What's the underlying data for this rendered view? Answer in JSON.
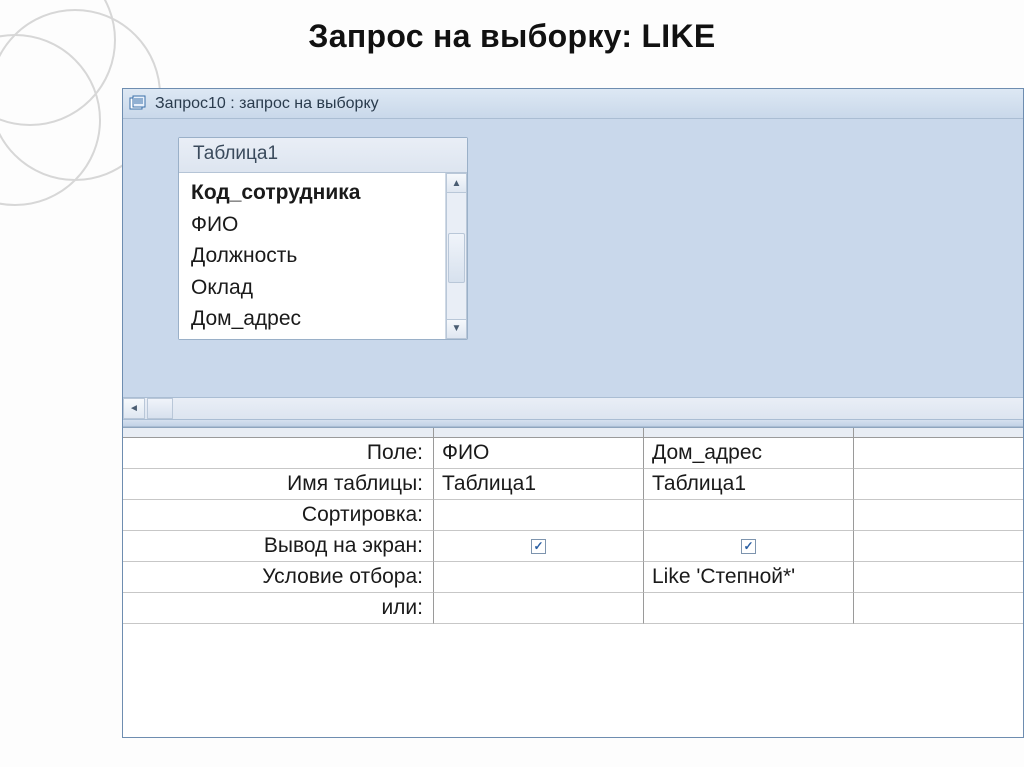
{
  "slide": {
    "title": "Запрос на выборку: LIKE"
  },
  "window": {
    "title": "Запрос10 : запрос на выборку"
  },
  "table_box": {
    "title": "Таблица1",
    "fields": [
      "Код_сотрудника",
      "ФИО",
      "Должность",
      "Оклад",
      "Дом_адрес"
    ]
  },
  "design_grid": {
    "row_labels": {
      "field": "Поле:",
      "table": "Имя таблицы:",
      "sort": "Сортировка:",
      "show": "Вывод на экран:",
      "criteria": "Условие отбора:",
      "or": "или:"
    },
    "columns": [
      {
        "field": "ФИО",
        "table": "Таблица1",
        "sort": "",
        "show": true,
        "criteria": "",
        "or": ""
      },
      {
        "field": "Дом_адрес",
        "table": "Таблица1",
        "sort": "",
        "show": true,
        "criteria": "Like 'Степной*'",
        "or": ""
      }
    ]
  }
}
